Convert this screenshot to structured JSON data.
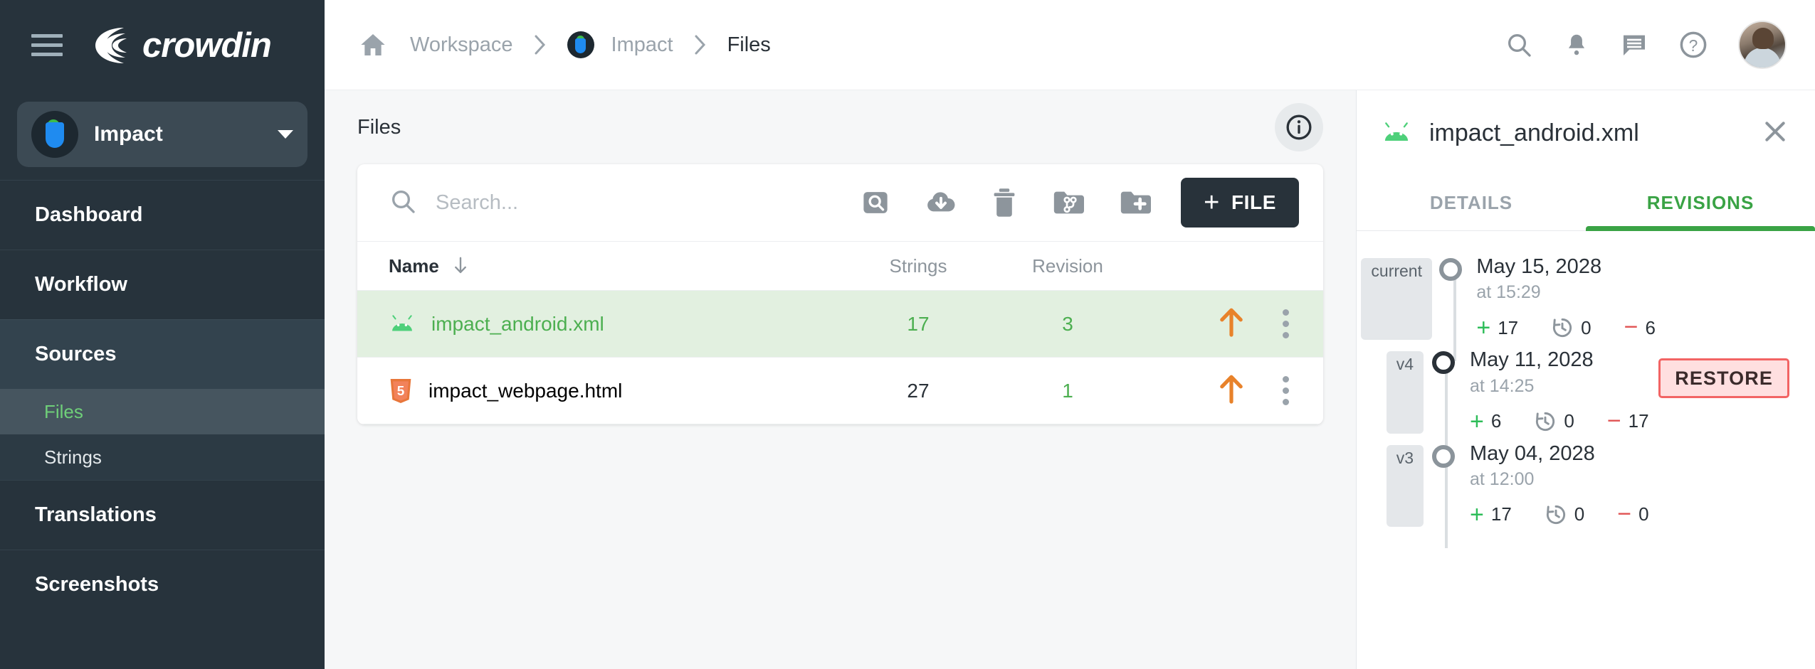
{
  "sidebar": {
    "logo_text": "crowdin",
    "project": {
      "name": "Impact"
    },
    "nav": [
      {
        "label": "Dashboard",
        "active": false
      },
      {
        "label": "Workflow",
        "active": false
      },
      {
        "label": "Sources",
        "active": true
      },
      {
        "label": "Translations",
        "active": false
      },
      {
        "label": "Screenshots",
        "active": false
      }
    ],
    "subnav": [
      {
        "label": "Files",
        "selected": true
      },
      {
        "label": "Strings",
        "selected": false
      }
    ]
  },
  "topbar": {
    "breadcrumb": [
      {
        "label": "Workspace",
        "current": false
      },
      {
        "label": "Impact",
        "current": false
      },
      {
        "label": "Files",
        "current": true
      }
    ],
    "icons": [
      "search-icon",
      "bell-icon",
      "chat-icon",
      "help-icon",
      "avatar"
    ]
  },
  "files": {
    "page_title": "Files",
    "info_button": "info-icon",
    "search": {
      "placeholder": "Search...",
      "value": ""
    },
    "tools": [
      {
        "name": "search-in-files-icon"
      },
      {
        "name": "download-cloud-icon"
      },
      {
        "name": "delete-icon"
      },
      {
        "name": "folder-branch-icon"
      },
      {
        "name": "add-folder-icon"
      }
    ],
    "add_file_label": "FILE",
    "columns": [
      "Name",
      "Strings",
      "Revision"
    ],
    "rows": [
      {
        "icon": "android-icon",
        "name": "impact_android.xml",
        "strings": "17",
        "revision": "3",
        "selected": true
      },
      {
        "icon": "html5-icon",
        "name": "impact_webpage.html",
        "strings": "27",
        "revision": "1",
        "selected": false
      }
    ]
  },
  "panel": {
    "file_icon": "android-icon",
    "title": "impact_android.xml",
    "close": "close-icon",
    "tabs": [
      {
        "label": "DETAILS",
        "active": false
      },
      {
        "label": "REVISIONS",
        "active": true
      }
    ],
    "revisions": [
      {
        "badge": "current",
        "date": "May 15, 2028",
        "time": "at 15:29",
        "added": "17",
        "updated": "0",
        "deleted": "6",
        "restore": null
      },
      {
        "badge": "v4",
        "date": "May 11, 2028",
        "time": "at 14:25",
        "added": "6",
        "updated": "0",
        "deleted": "17",
        "restore": "RESTORE"
      },
      {
        "badge": "v3",
        "date": "May 04, 2028",
        "time": "at 12:00",
        "added": "17",
        "updated": "0",
        "deleted": "0",
        "restore": null
      }
    ]
  },
  "colors": {
    "sidebar_bg": "#27333c",
    "accent_green": "#4caf50",
    "tab_green": "#3aa345",
    "row_selected_bg": "#e2f0e0",
    "upload_orange": "#e8822a",
    "restore_border": "#f26464",
    "restore_bg": "#ffdfe0",
    "dark_button": "#28323a"
  }
}
